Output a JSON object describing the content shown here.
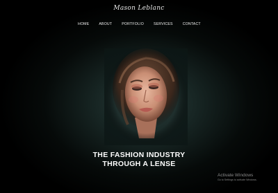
{
  "site": {
    "logo_text": "Mason Leblanc"
  },
  "nav": {
    "items": [
      "HOME",
      "ABOUT",
      "PORTFOLIO",
      "SERVICES",
      "CONTACT"
    ]
  },
  "hero": {
    "headline_line1": "THE FASHION INDUSTRY",
    "headline_line2": "THROUGH A LENSE",
    "image_subject": "fashion-model-portrait"
  },
  "os_overlay": {
    "title": "Activate Windows",
    "subtitle": "Go to Settings to activate Windows."
  },
  "colors": {
    "background": "#000000",
    "glow": "#2b3e3c",
    "text": "#ffffff"
  }
}
